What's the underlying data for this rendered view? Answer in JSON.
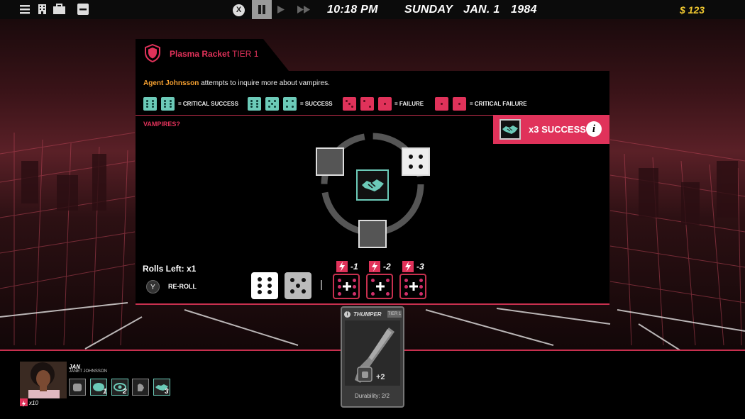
{
  "topbar": {
    "close_glyph": "X",
    "time": "10:18 PM",
    "day": "SUNDAY",
    "date": "JAN. 1",
    "year": "1984",
    "money": "$ 123",
    "icons": [
      "menu-icon",
      "building-icon",
      "briefcase-icon",
      "minimize-icon",
      "close-icon",
      "pause-icon",
      "play-icon",
      "fast-forward-icon"
    ]
  },
  "panel": {
    "title": "Plasma Racket",
    "tier": "TIER 1",
    "agent": "Agent Johnsson",
    "description": " attempts to inquire more about vampires.",
    "legend": {
      "critical_success": "= CRITICAL SUCCESS",
      "success": "= SUCCESS",
      "failure": "= FAILURE",
      "critical_failure": "= CRITICAL FAILURE"
    },
    "subject": "VAMPIRES?",
    "result": "x3 SUCCESS",
    "info_glyph": "i",
    "rolls_left": "Rolls Left: x1",
    "reroll_button": "Y",
    "reroll_label": "RE-ROLL",
    "boosts": [
      "-1",
      "-2",
      "-3"
    ],
    "rolled_dice": [
      6,
      5
    ],
    "colors": {
      "accent": "#e0325a",
      "teal": "#6ccab8",
      "gold": "#f5a030"
    }
  },
  "character": {
    "name": "JAN",
    "full_name": "JANET JOHNSSON",
    "energy": "x10",
    "skills": [
      {
        "icon": "fist-icon",
        "level": ""
      },
      {
        "icon": "brain-icon",
        "level": "1"
      },
      {
        "icon": "eye-icon",
        "level": "2"
      },
      {
        "icon": "hand-icon",
        "level": ""
      },
      {
        "icon": "handshake-icon",
        "level": "3"
      }
    ]
  },
  "card": {
    "title": "THUMPER",
    "tier": "TIER 1",
    "bonus": "+2",
    "durability": "Durability: 2/2"
  }
}
